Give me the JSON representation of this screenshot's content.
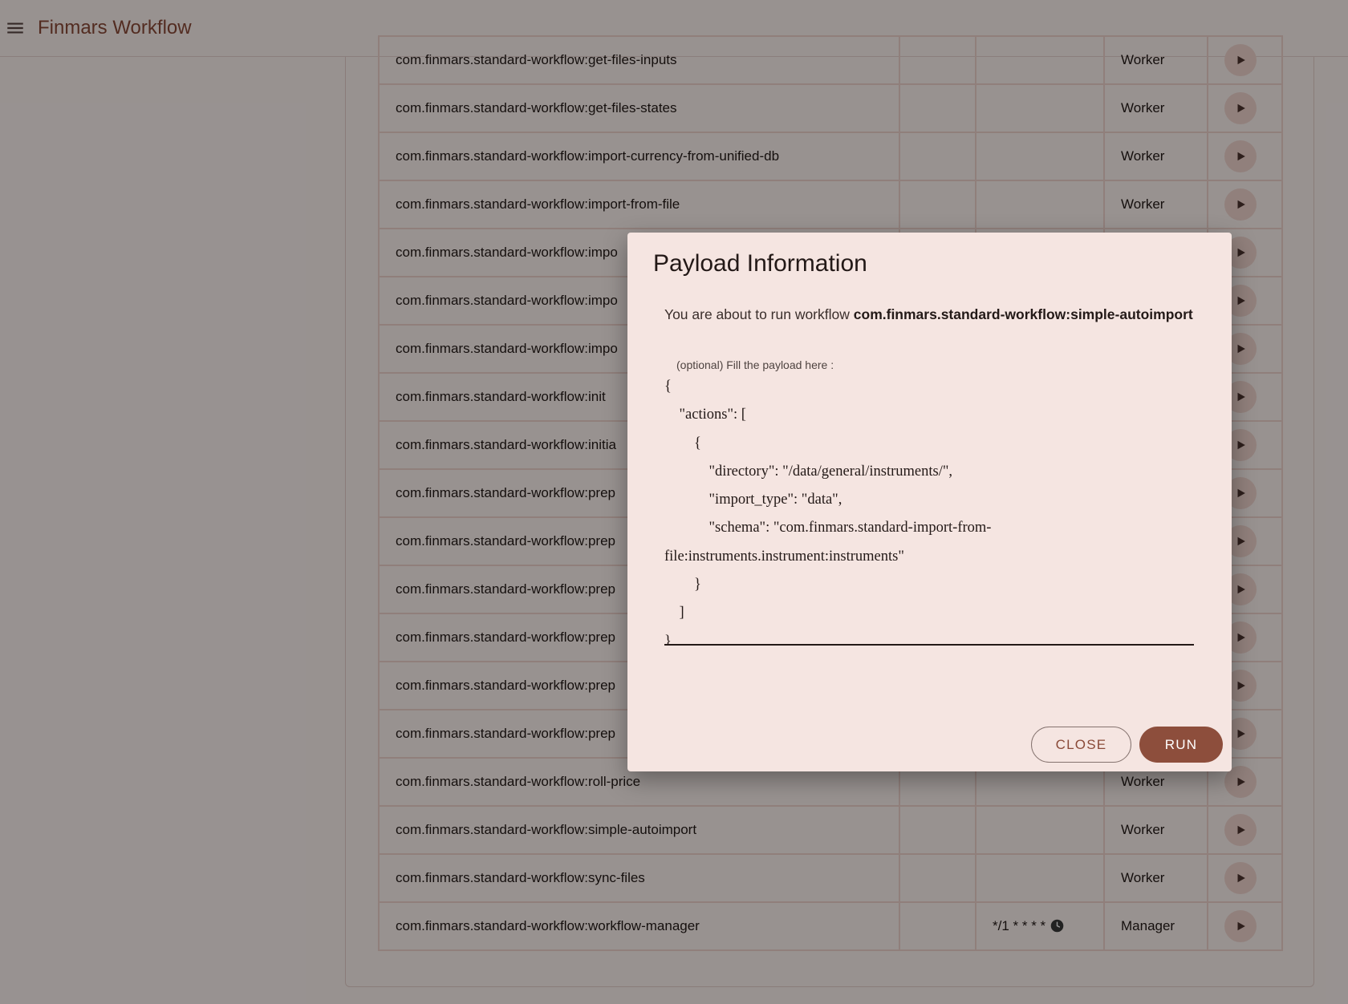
{
  "app": {
    "title": "Finmars Workflow"
  },
  "workflows": [
    {
      "name": "com.finmars.standard-workflow:get-files-inputs",
      "schedule": "",
      "type": "Worker"
    },
    {
      "name": "com.finmars.standard-workflow:get-files-states",
      "schedule": "",
      "type": "Worker"
    },
    {
      "name": "com.finmars.standard-workflow:import-currency-from-unified-db",
      "schedule": "",
      "type": "Worker"
    },
    {
      "name": "com.finmars.standard-workflow:import-from-file",
      "schedule": "",
      "type": "Worker"
    },
    {
      "name": "com.finmars.standard-workflow:impo",
      "schedule": "",
      "type": ""
    },
    {
      "name": "com.finmars.standard-workflow:impo",
      "schedule": "",
      "type": ""
    },
    {
      "name": "com.finmars.standard-workflow:impo",
      "schedule": "",
      "type": ""
    },
    {
      "name": "com.finmars.standard-workflow:init",
      "schedule": "",
      "type": ""
    },
    {
      "name": "com.finmars.standard-workflow:initia",
      "schedule": "",
      "type": ""
    },
    {
      "name": "com.finmars.standard-workflow:prep",
      "schedule": "",
      "type": ""
    },
    {
      "name": "com.finmars.standard-workflow:prep",
      "schedule": "",
      "type": ""
    },
    {
      "name": "com.finmars.standard-workflow:prep",
      "schedule": "",
      "type": ""
    },
    {
      "name": "com.finmars.standard-workflow:prep",
      "schedule": "",
      "type": ""
    },
    {
      "name": "com.finmars.standard-workflow:prep",
      "schedule": "",
      "type": ""
    },
    {
      "name": "com.finmars.standard-workflow:prep",
      "schedule": "",
      "type": ""
    },
    {
      "name": "com.finmars.standard-workflow:roll-price",
      "schedule": "",
      "type": "Worker"
    },
    {
      "name": "com.finmars.standard-workflow:simple-autoimport",
      "schedule": "",
      "type": "Worker"
    },
    {
      "name": "com.finmars.standard-workflow:sync-files",
      "schedule": "",
      "type": "Worker"
    },
    {
      "name": "com.finmars.standard-workflow:workflow-manager",
      "schedule": "*/1 * * * *",
      "type": "Manager",
      "has_clock": true
    }
  ],
  "dialog": {
    "title": "Payload Information",
    "message_prefix": "You are about to run workflow",
    "workflow_name": "com.finmars.standard-workflow:simple-autoimport",
    "payload_label": "(optional) Fill the payload here :",
    "payload_value": "{\n    \"actions\": [\n        {\n            \"directory\": \"/data/general/instruments/\",\n            \"import_type\": \"data\",\n            \"schema\": \"com.finmars.standard-import-from-file:instruments.instrument:instruments\"\n        }\n    ]\n}",
    "close_label": "CLOSE",
    "run_label": "RUN"
  },
  "icons": {
    "menu": "menu-icon",
    "play": "play-icon",
    "clock": "clock-icon"
  },
  "colors": {
    "accent": "#8d4e3c",
    "surface": "#f5e5e1",
    "title": "#8a4a38"
  }
}
